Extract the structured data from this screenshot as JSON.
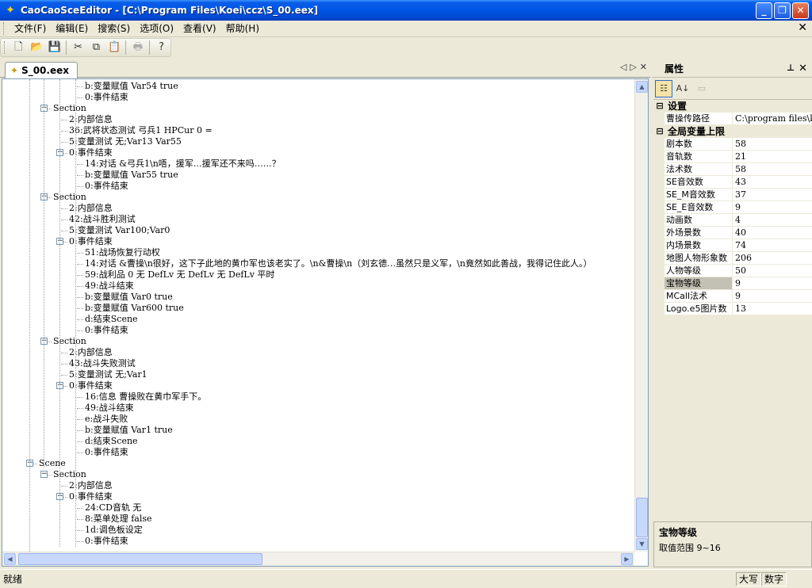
{
  "window": {
    "title": "CaoCaoSceEditor - [C:\\Program Files\\Koei\\ccz\\S_00.eex]",
    "app_icon": "cao-cao-logo-icon"
  },
  "menu": {
    "items": [
      "文件(F)",
      "编辑(E)",
      "搜索(S)",
      "选项(O)",
      "查看(V)",
      "帮助(H)"
    ]
  },
  "toolbar": {
    "buttons": [
      "new-file-icon",
      "open-folder-icon",
      "save-icon",
      "cut-icon",
      "copy-icon",
      "paste-icon",
      "print-icon",
      "help-icon"
    ]
  },
  "document": {
    "tab_label": "S_00.eex"
  },
  "tree": {
    "nodes": [
      {
        "level": 4,
        "text": "b:变量赋值 Var54 true"
      },
      {
        "level": 4,
        "text": "0:事件结束"
      },
      {
        "level": 2,
        "text": "Section",
        "expander": "−"
      },
      {
        "level": 3,
        "text": "2:内部信息"
      },
      {
        "level": 3,
        "text": "36:武将状态测试 弓兵1 HPCur 0 ="
      },
      {
        "level": 3,
        "text": "5:变量测试 无;Var13 Var55"
      },
      {
        "level": 3,
        "text": "0:事件结束",
        "expander": "−"
      },
      {
        "level": 4,
        "text": "14:对话 &弓兵1\\n唔，援军…援军还不来吗……？"
      },
      {
        "level": 4,
        "text": "b:变量赋值 Var55 true"
      },
      {
        "level": 4,
        "text": "0:事件结束"
      },
      {
        "level": 2,
        "text": "Section",
        "expander": "−"
      },
      {
        "level": 3,
        "text": "2:内部信息"
      },
      {
        "level": 3,
        "text": "42:战斗胜利测试"
      },
      {
        "level": 3,
        "text": "5:变量测试 Var100;Var0"
      },
      {
        "level": 3,
        "text": "0:事件结束",
        "expander": "−"
      },
      {
        "level": 4,
        "text": "51:战场恢复行动权"
      },
      {
        "level": 4,
        "text": "14:对话 &曹操\\n很好，这下子此地的黄巾军也该老实了。\\n&曹操\\n（刘玄德…虽然只是义军，\\n竟然如此善战，我得记住此人。）"
      },
      {
        "level": 4,
        "text": "59:战利品 0 无 DefLv 无 DefLv 无 DefLv 平时"
      },
      {
        "level": 4,
        "text": "49:战斗结束"
      },
      {
        "level": 4,
        "text": "b:变量赋值 Var0 true"
      },
      {
        "level": 4,
        "text": "b:变量赋值 Var600 true"
      },
      {
        "level": 4,
        "text": "d:结束Scene"
      },
      {
        "level": 4,
        "text": "0:事件结束"
      },
      {
        "level": 2,
        "text": "Section",
        "expander": "−"
      },
      {
        "level": 3,
        "text": "2:内部信息"
      },
      {
        "level": 3,
        "text": "43:战斗失败测试"
      },
      {
        "level": 3,
        "text": "5:变量测试 无;Var1"
      },
      {
        "level": 3,
        "text": "0:事件结束",
        "expander": "−"
      },
      {
        "level": 4,
        "text": "16:信息 曹操败在黄巾军手下。"
      },
      {
        "level": 4,
        "text": "49:战斗结束"
      },
      {
        "level": 4,
        "text": "e:战斗失败"
      },
      {
        "level": 4,
        "text": "b:变量赋值 Var1 true"
      },
      {
        "level": 4,
        "text": "d:结束Scene"
      },
      {
        "level": 4,
        "text": "0:事件结束"
      },
      {
        "level": 1,
        "text": "Scene",
        "expander": "−"
      },
      {
        "level": 2,
        "text": "Section",
        "expander": "−"
      },
      {
        "level": 3,
        "text": "2:内部信息"
      },
      {
        "level": 3,
        "text": "0:事件结束",
        "expander": "−"
      },
      {
        "level": 4,
        "text": "24:CD音轨 无"
      },
      {
        "level": 4,
        "text": "8:菜单处理 false"
      },
      {
        "level": 4,
        "text": "1d:调色板设定"
      },
      {
        "level": 4,
        "text": "0:事件结束"
      }
    ]
  },
  "properties": {
    "title": "属性",
    "pin_icon": "pin-icon",
    "toolbar": [
      "categorized-icon",
      "alphabetical-icon",
      "property-pages-icon"
    ],
    "categories": [
      {
        "label": "设置",
        "rows": [
          {
            "name": "曹操传路径",
            "value": "C:\\program files\\koei"
          }
        ]
      },
      {
        "label": "全局变量上限",
        "rows": [
          {
            "name": "剧本数",
            "value": "58"
          },
          {
            "name": "音轨数",
            "value": "21"
          },
          {
            "name": "法术数",
            "value": "58"
          },
          {
            "name": "SE音效数",
            "value": "43"
          },
          {
            "name": "SE_M音效数",
            "value": "37"
          },
          {
            "name": "SE_E音效数",
            "value": "9"
          },
          {
            "name": "动画数",
            "value": "4"
          },
          {
            "name": "外场景数",
            "value": "40"
          },
          {
            "name": "内场景数",
            "value": "74"
          },
          {
            "name": "地图人物形象数",
            "value": "206"
          },
          {
            "name": "人物等级",
            "value": "50"
          },
          {
            "name": "宝物等级",
            "value": "9",
            "selected": true
          },
          {
            "name": "MCall法术",
            "value": "9"
          },
          {
            "name": "Logo.e5图片数",
            "value": "13"
          }
        ]
      }
    ],
    "description": {
      "title": "宝物等级",
      "text": "取值范围 9~16"
    }
  },
  "status": {
    "text": "就绪",
    "caps": "大写",
    "num": "数字"
  }
}
